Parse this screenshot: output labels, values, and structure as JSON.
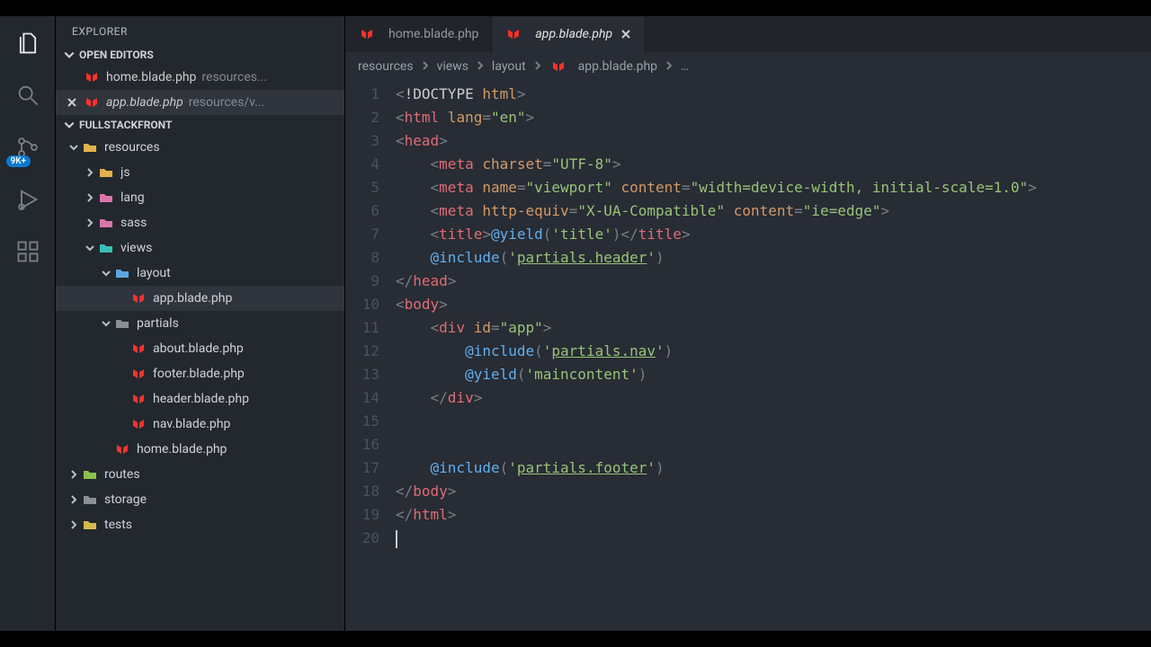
{
  "topbar": {},
  "activitybar": {
    "badge_scm": "9K+"
  },
  "sidebar": {
    "title": "EXPLORER",
    "openEditors": {
      "label": "OPEN EDITORS",
      "items": [
        {
          "name": "home.blade.php",
          "dim": "resources...",
          "italic": false,
          "closeable": false,
          "active": false
        },
        {
          "name": "app.blade.php",
          "dim": "resources/v...",
          "italic": true,
          "closeable": true,
          "active": true
        }
      ]
    },
    "project": {
      "label": "FULLSTACKFRONT",
      "tree": [
        {
          "depth": 0,
          "twisty": "down",
          "icon": "folder-y",
          "label": "resources"
        },
        {
          "depth": 1,
          "twisty": "right",
          "icon": "folder-y",
          "label": "js"
        },
        {
          "depth": 1,
          "twisty": "right",
          "icon": "folder-p",
          "label": "lang"
        },
        {
          "depth": 1,
          "twisty": "right",
          "icon": "folder-p",
          "label": "sass"
        },
        {
          "depth": 1,
          "twisty": "down",
          "icon": "folder-t",
          "label": "views"
        },
        {
          "depth": 2,
          "twisty": "down",
          "icon": "folder-b",
          "label": "layout"
        },
        {
          "depth": 3,
          "twisty": "",
          "icon": "laravel",
          "label": "app.blade.php",
          "active": true
        },
        {
          "depth": 2,
          "twisty": "down",
          "icon": "folder-gr",
          "label": "partials"
        },
        {
          "depth": 3,
          "twisty": "",
          "icon": "laravel",
          "label": "about.blade.php"
        },
        {
          "depth": 3,
          "twisty": "",
          "icon": "laravel",
          "label": "footer.blade.php"
        },
        {
          "depth": 3,
          "twisty": "",
          "icon": "laravel",
          "label": "header.blade.php"
        },
        {
          "depth": 3,
          "twisty": "",
          "icon": "laravel",
          "label": "nav.blade.php"
        },
        {
          "depth": 2,
          "twisty": "",
          "icon": "laravel",
          "label": "home.blade.php"
        },
        {
          "depth": 0,
          "twisty": "right",
          "icon": "folder-g",
          "label": "routes"
        },
        {
          "depth": 0,
          "twisty": "right",
          "icon": "folder-gr",
          "label": "storage"
        },
        {
          "depth": 0,
          "twisty": "right",
          "icon": "folder-ye",
          "label": "tests"
        }
      ]
    }
  },
  "tabs": [
    {
      "name": "home.blade.php",
      "active": false,
      "closeable": false
    },
    {
      "name": "app.blade.php",
      "active": true,
      "closeable": true,
      "italic": true
    }
  ],
  "breadcrumb": {
    "parts": [
      "resources",
      "views",
      "layout"
    ],
    "file": "app.blade.php",
    "more": "…"
  },
  "code": {
    "lines": 20
  },
  "tokens": {
    "doctype": "!DOCTYPE",
    "html": "html",
    "head": "head",
    "body": "body",
    "meta": "meta",
    "title": "title",
    "div": "div",
    "lang": "lang",
    "en": "\"en\"",
    "charset": "charset",
    "utf8": "\"UTF-8\"",
    "name": "name",
    "viewport": "\"viewport\"",
    "content": "content",
    "vp_val": "\"width=device-width, initial-scale=1.0\"",
    "httpequiv": "http-equiv",
    "xua": "\"X-UA-Compatible\"",
    "ieedge": "\"ie=edge\"",
    "yield": "@yield",
    "include": "@include",
    "q_title": "'title'",
    "q_header": "'partials.header'",
    "id": "id",
    "app": "\"app\"",
    "q_nav": "'partials.nav'",
    "q_main": "'maincontent'",
    "q_footer": "'partials.footer'"
  }
}
